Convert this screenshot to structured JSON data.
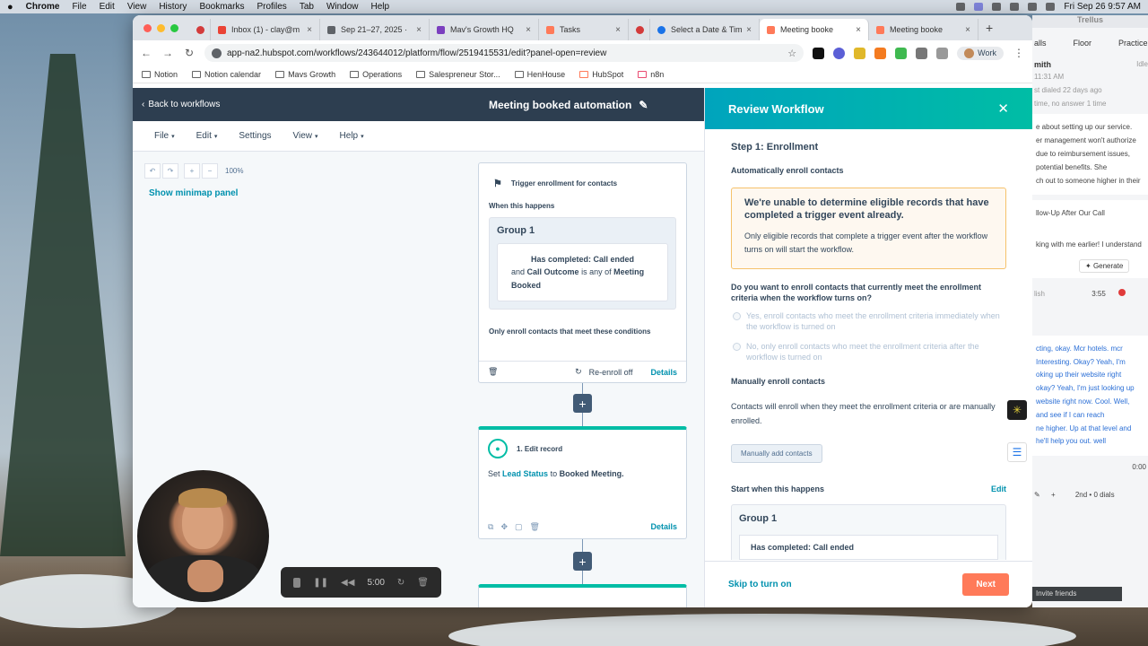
{
  "menubar": {
    "app": "Chrome",
    "items": [
      "File",
      "Edit",
      "View",
      "History",
      "Bookmarks",
      "Profiles",
      "Tab",
      "Window",
      "Help"
    ],
    "clock": "Fri Sep 26  9:57 AM"
  },
  "tabs": [
    {
      "title": "",
      "color": "#d33b3b"
    },
    {
      "title": "Inbox (1) - clay@m",
      "color": "#ea4335"
    },
    {
      "title": "Sep 21–27, 2025 ·",
      "color": "#5f6368"
    },
    {
      "title": "Mav's Growth HQ",
      "color": "#7b3fbf"
    },
    {
      "title": "Tasks",
      "color": "#ff7a59"
    },
    {
      "title": "",
      "color": "#d33b3b"
    },
    {
      "title": "Select a Date & Tim",
      "color": "#1a73e8"
    },
    {
      "title": "Meeting booke",
      "color": "#ff7a59"
    },
    {
      "title": "Meeting booke",
      "color": "#ff7a59"
    }
  ],
  "browser": {
    "url": "app-na2.hubspot.com/workflows/243644012/platform/flow/2519415531/edit?panel-open=review",
    "profile": "Work"
  },
  "bookmarks": [
    "Notion",
    "Notion calendar",
    "Mavs Growth",
    "Operations",
    "Salespreneur Stor...",
    "HenHouse",
    "HubSpot",
    "n8n"
  ],
  "header": {
    "back": "Back to workflows",
    "title": "Meeting booked automation"
  },
  "menu": [
    "File",
    "Edit",
    "Settings",
    "View",
    "Help"
  ],
  "canvas": {
    "zoom": "100%",
    "minimap": "Show minimap panel",
    "trigger": {
      "title": "Trigger enrollment for contacts",
      "when": "When this happens",
      "group": "Group 1",
      "condition1": "Has completed: Call ended",
      "cond_and": "and",
      "cond_prop": "Call Outcome",
      "cond_is": "is any of",
      "cond_value": "Meeting Booked",
      "only": "Only enroll contacts that meet these conditions",
      "reenroll": "Re-enroll off",
      "details": "Details"
    },
    "action": {
      "title": "1. Edit record",
      "set": "Set",
      "property": "Lead Status",
      "to": "to",
      "value": "Booked Meeting.",
      "details": "Details"
    }
  },
  "review": {
    "title": "Review Workflow",
    "step": "Step 1: Enrollment",
    "auto": "Automatically enroll contacts",
    "warn_title": "We're unable to determine eligible records that have completed a trigger event already.",
    "warn_text": "Only eligible records that complete a trigger event after the workflow turns on will start the workflow.",
    "question": "Do you want to enroll contacts that currently meet the enrollment criteria when the workflow turns on?",
    "opt_yes": "Yes, enroll contacts who meet the enrollment criteria immediately when the workflow is turned on",
    "opt_no": "No, only enroll contacts who meet the enrollment criteria after the workflow is turned on",
    "manual_h": "Manually enroll contacts",
    "manual_text": "Contacts will enroll when they meet the enrollment criteria or are manually enrolled.",
    "manual_btn": "Manually add contacts",
    "start": "Start when this happens",
    "edit": "Edit",
    "group": "Group 1",
    "group_cond": "Has completed: Call ended",
    "skip": "Skip to turn on",
    "next": "Next"
  },
  "trellus": {
    "title": "Trellus",
    "tab1": "alls",
    "tab2": "Floor",
    "tab3": "Practice",
    "name": "mith",
    "status": "Idle",
    "time_small": "11:31 AM",
    "last": "st dialed 22 days ago",
    "last2": "time, no answer 1 time",
    "note1": "e about setting up our service.",
    "note2": "er management won't authorize",
    "note3": "due to reimbursement issues,",
    "note4": "potential benefits. She",
    "note5": "ch out to someone higher in their",
    "follow": "llow-Up After Our Call",
    "talk": "king with me earlier! I understand",
    "generate": "Generate",
    "lang": "lish",
    "timer": "3:55",
    "tr1": "cting, okay. Mcr hotels. mcr",
    "tr2": "Interesting. Okay? Yeah, I'm",
    "tr3": "oking up their website right",
    "tr4": "okay? Yeah, I'm just looking up",
    "tr5": "website right now. Cool. Well,",
    "tr6": "and see if I can reach",
    "tr7": "ne higher. Up at that level and",
    "tr8": "he'll help you out. well",
    "zero": "0:00",
    "dials": "2nd • 0 dials",
    "invite": "Invite friends"
  },
  "recorder": {
    "time": "5:00"
  }
}
